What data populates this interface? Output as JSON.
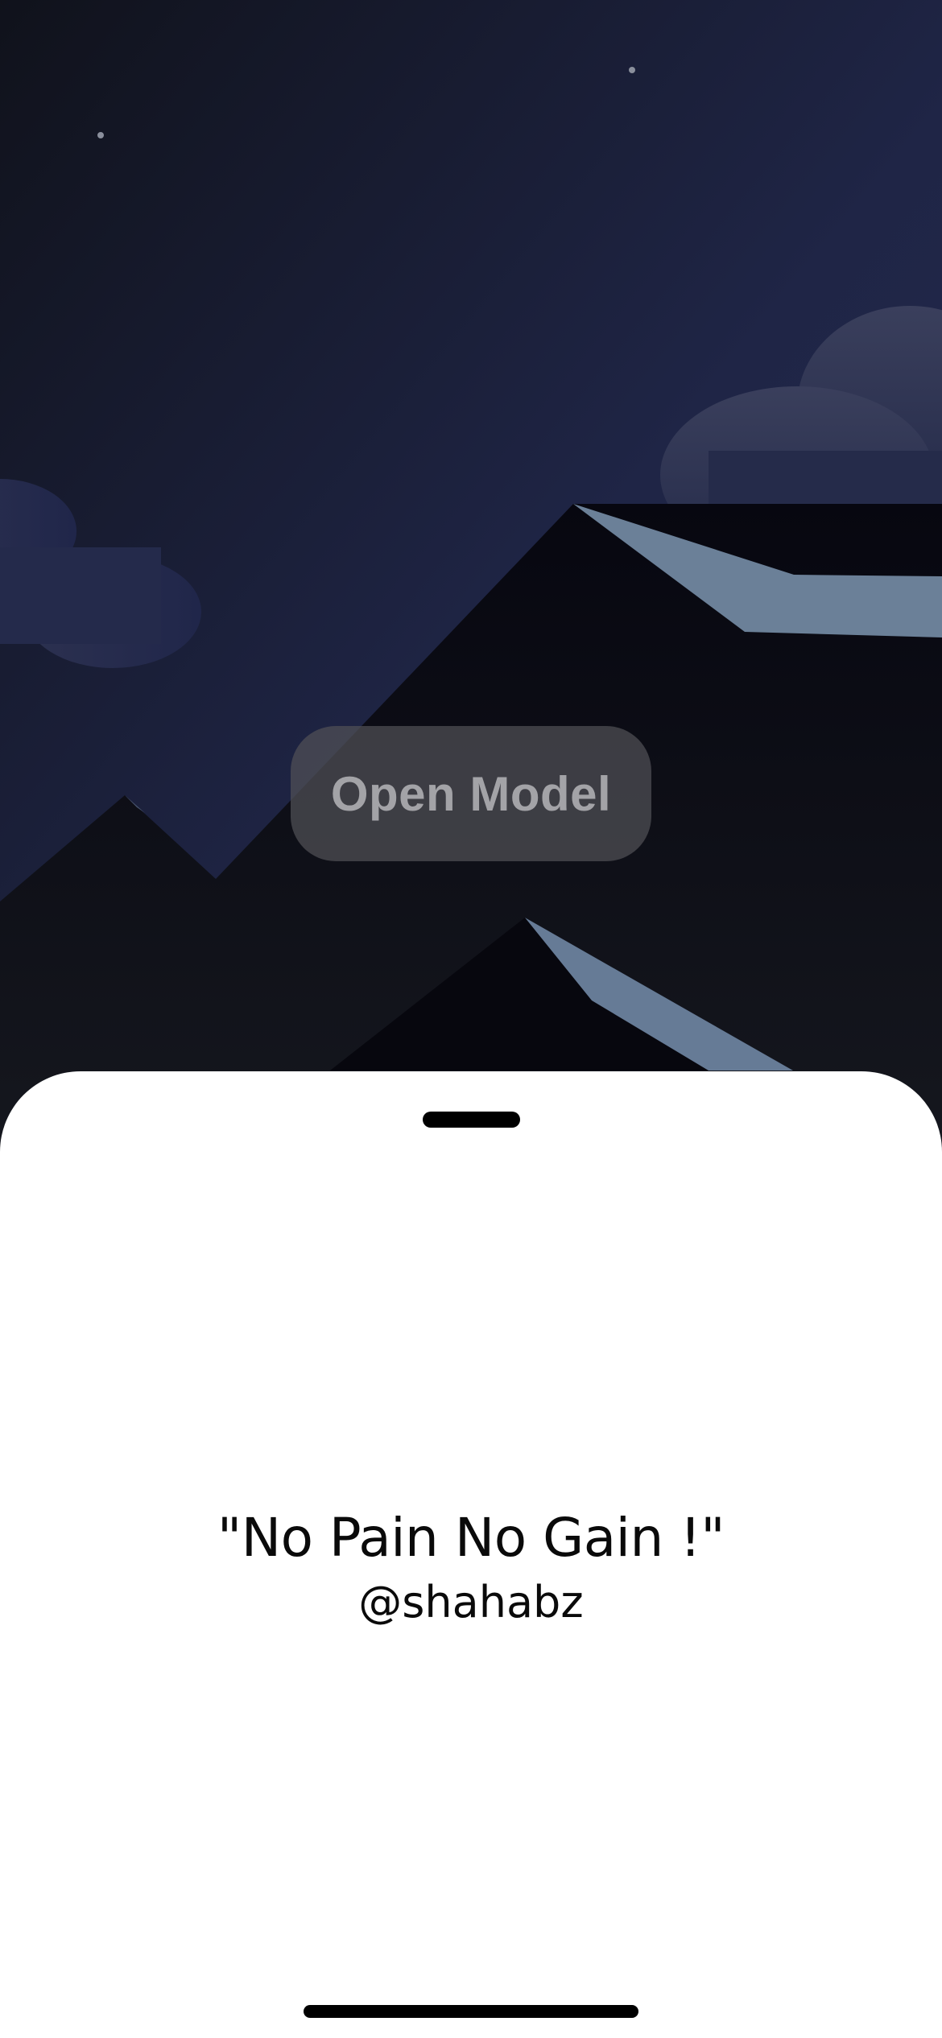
{
  "background": {
    "scene": "night-mountains",
    "colors": {
      "sky_top": "#12141f",
      "sky_mid": "#1e2444",
      "mountain_dark": "#08080f",
      "snow": "#6b8098",
      "star": "#8a8f9c"
    }
  },
  "main": {
    "open_model_label": "Open Model"
  },
  "sheet": {
    "quote": "\"No Pain No Gain !\"",
    "author": "@shahabz"
  }
}
